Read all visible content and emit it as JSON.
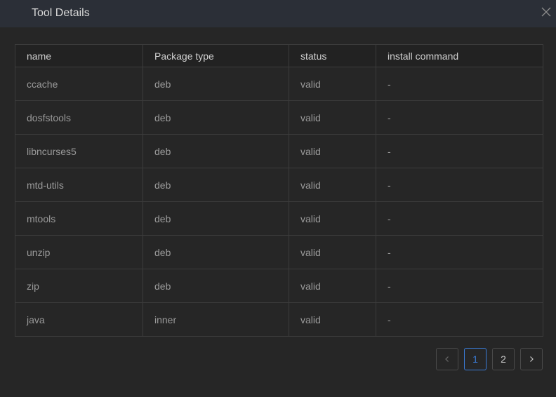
{
  "dialog": {
    "title": "Tool Details",
    "close_icon": "close-icon"
  },
  "table": {
    "columns": [
      "name",
      "Package type",
      "status",
      "install command"
    ],
    "rows": [
      [
        "ccache",
        "deb",
        "valid",
        "-"
      ],
      [
        "dosfstools",
        "deb",
        "valid",
        "-"
      ],
      [
        "libncurses5",
        "deb",
        "valid",
        "-"
      ],
      [
        "mtd-utils",
        "deb",
        "valid",
        "-"
      ],
      [
        "mtools",
        "deb",
        "valid",
        "-"
      ],
      [
        "unzip",
        "deb",
        "valid",
        "-"
      ],
      [
        "zip",
        "deb",
        "valid",
        "-"
      ],
      [
        "java",
        "inner",
        "valid",
        "-"
      ]
    ]
  },
  "pagination": {
    "prev_icon": "chevron-left-icon",
    "next_icon": "chevron-right-icon",
    "pages": [
      "1",
      "2"
    ],
    "current": "1"
  },
  "colors": {
    "accent": "#3a7bd5",
    "header_bg": "#2b2f37",
    "body_bg": "#262626"
  }
}
